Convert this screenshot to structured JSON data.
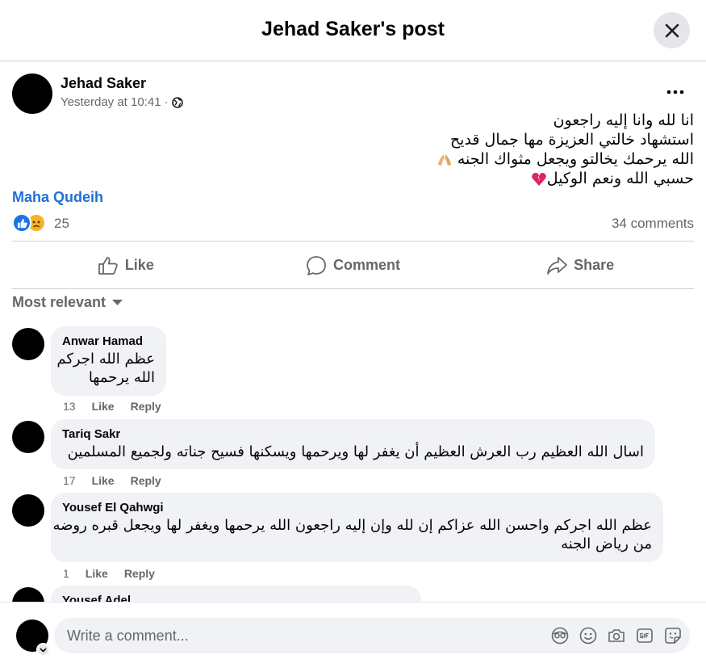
{
  "header": {
    "title": "Jehad Saker's post"
  },
  "post": {
    "author": "Jehad Saker",
    "time": "Yesterday at 10:41",
    "separator": "·",
    "lines": [
      "انا لله وانا إليه راجعون",
      "استشهاد خالتي العزيزة مها جمال قديح",
      "الله يرحمك يخالتو ويجعل مثواك الجنه",
      "حسبي الله ونعم الوكيل"
    ],
    "tag": "Maha Qudeih",
    "reaction_count": "25",
    "comments_count": "34 comments"
  },
  "actions": {
    "like": "Like",
    "comment": "Comment",
    "share": "Share"
  },
  "sort": {
    "label": "Most relevant"
  },
  "comments": [
    {
      "name": "Anwar Hamad",
      "lines": [
        "عظم الله اجركم",
        "الله يرحمها"
      ],
      "time": "13",
      "like": "Like",
      "reply": "Reply"
    },
    {
      "name": "Tariq Sakr",
      "lines": [
        "اسال الله العظيم رب العرش العظيم أن يغفر لها ويرحمها ويسكنها فسيح جناته ولجميع المسلمين"
      ],
      "time": "17",
      "like": "Like",
      "reply": "Reply"
    },
    {
      "name": "Yousef El Qahwgi",
      "lines": [
        "عظم الله اجركم واحسن الله عزاكم إن لله وإن إليه راجعون الله يرحمها ويغفر لها ويجعل قبره روضه",
        "من رياض الجنه"
      ],
      "time": "1",
      "like": "Like",
      "reply": "Reply"
    },
    {
      "name": "Yousef Adel"
    }
  ],
  "composer": {
    "placeholder": "Write a comment..."
  },
  "icons": {
    "close": "close-icon",
    "globe": "globe-icon",
    "more": "more-icon",
    "like": "thumbs-up-icon",
    "comment": "comment-icon",
    "share": "share-icon",
    "sort": "chevron-down-icon",
    "avatar": "sticker-icon",
    "emoji": "emoji-icon",
    "camera": "camera-icon",
    "gif": "gif-icon",
    "sticker": "sticker-icon"
  },
  "colors": {
    "link": "#216fdb",
    "secondary": "#65676b",
    "bubble": "#f0f2f5",
    "like": "#1b74e4",
    "sad": "#f7b125"
  }
}
